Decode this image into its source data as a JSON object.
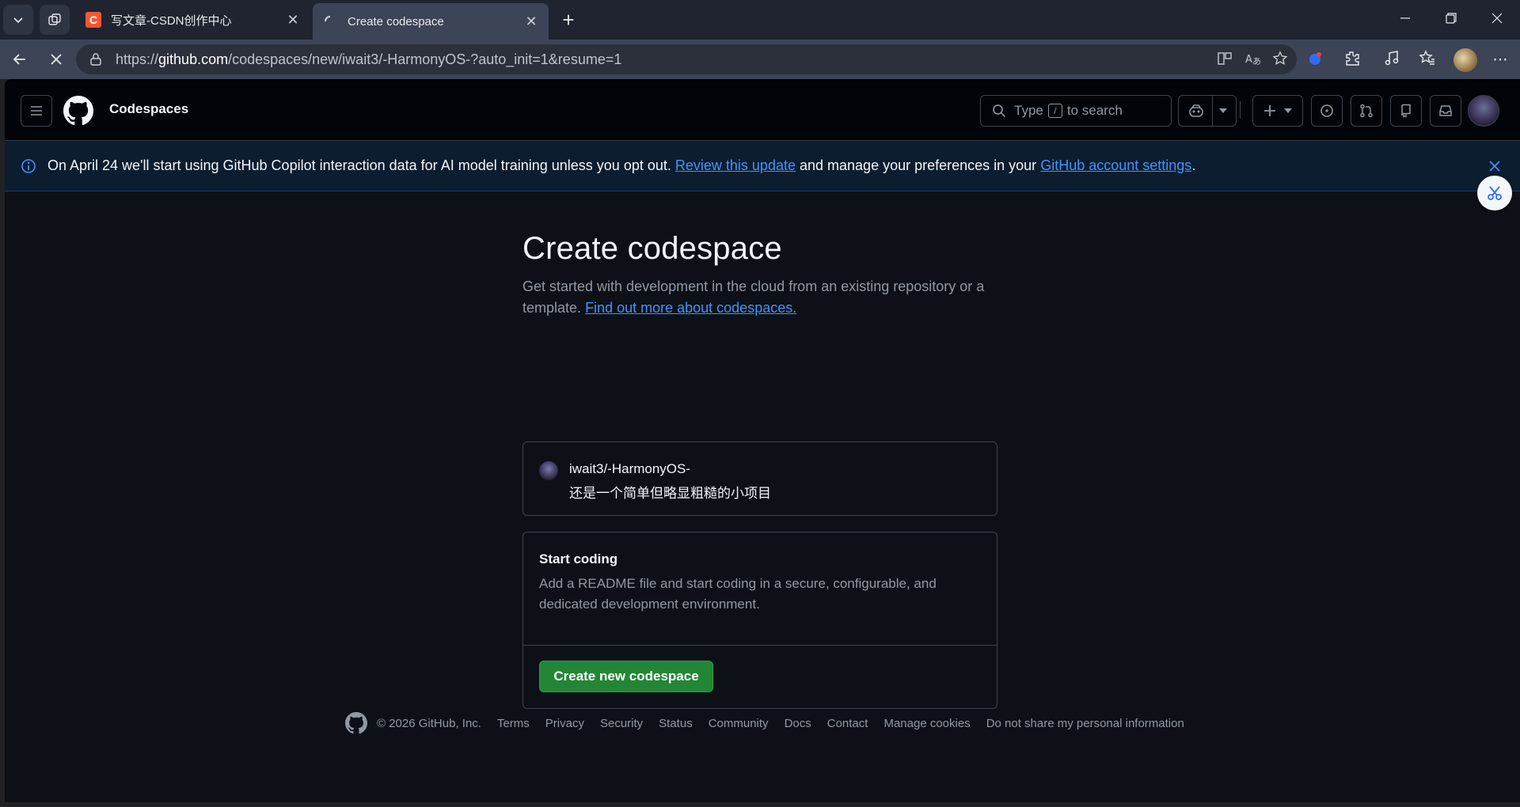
{
  "browser": {
    "tabs": [
      {
        "title": "写文章-CSDN创作中心",
        "favicon_letter": "C",
        "favicon_color": "#fc5531"
      },
      {
        "title": "Create codespace"
      }
    ],
    "url_domain": "github.com",
    "url_prefix": "https://",
    "url_path": "/codespaces/new/iwait3/-HarmonyOS-?auto_init=1&resume=1"
  },
  "header": {
    "context": "Codespaces",
    "search_prefix": "Type",
    "search_key": "/",
    "search_suffix": "to search"
  },
  "banner": {
    "text_before": "On April 24 we'll start using GitHub Copilot interaction data for AI model training unless you opt out.",
    "link1": "Review this update",
    "text_middle": "and manage your preferences in your",
    "link2": "GitHub account settings",
    "text_after": "."
  },
  "main": {
    "title": "Create codespace",
    "subtitle": "Get started with development in the cloud from an existing repository or a template.",
    "subtitle_link": "Find out more about codespaces.",
    "repo": {
      "name": "iwait3/-HarmonyOS-",
      "description": "还是一个简单但略显粗糙的小项目"
    },
    "start": {
      "title": "Start coding",
      "description": "Add a README file and start coding in a secure, configurable, and dedicated development environment.",
      "button": "Create new codespace"
    }
  },
  "footer": {
    "copyright": "© 2026 GitHub, Inc.",
    "links": [
      "Terms",
      "Privacy",
      "Security",
      "Status",
      "Community",
      "Docs",
      "Contact",
      "Manage cookies",
      "Do not share my personal information"
    ]
  },
  "colors": {
    "primary_button": "#238636",
    "link": "#4493f8",
    "page_bg": "#0d1117"
  }
}
